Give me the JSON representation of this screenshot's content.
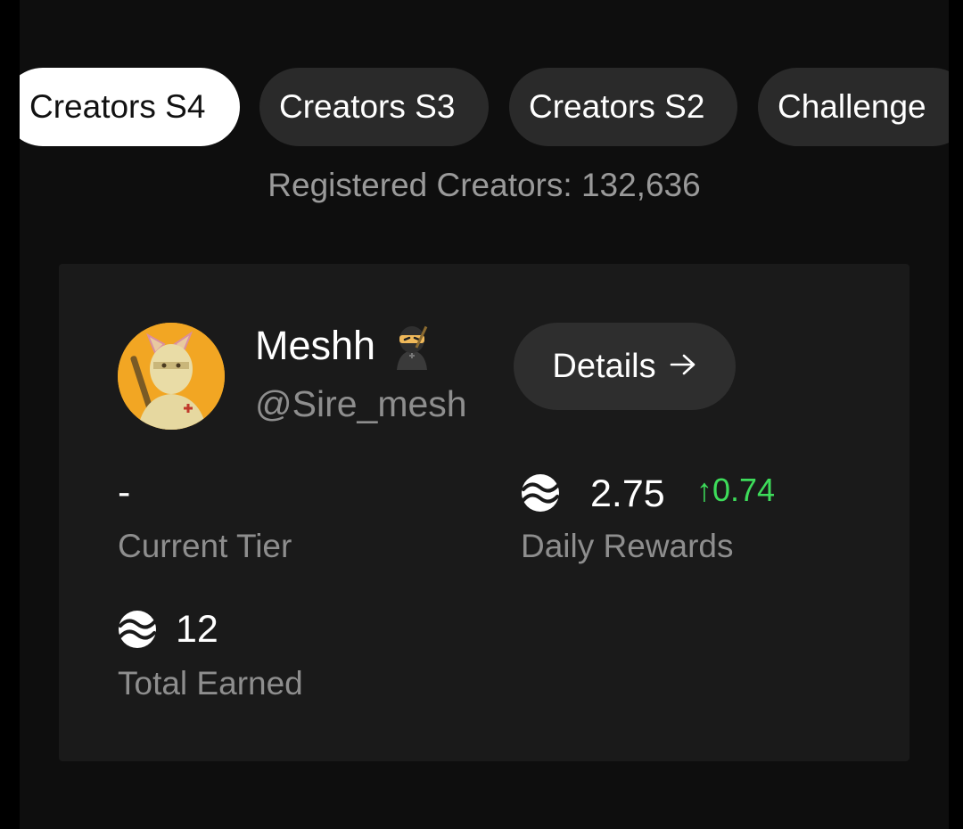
{
  "tabs": [
    {
      "label": "Creators S4",
      "active": true
    },
    {
      "label": "Creators S3",
      "active": false
    },
    {
      "label": "Creators S2",
      "active": false
    },
    {
      "label": "Challenge",
      "active": false
    }
  ],
  "registered_creators": "Registered Creators: 132,636",
  "profile": {
    "name": "Meshh",
    "emoji": "ninja",
    "handle": "@Sire_mesh",
    "details_label": "Details",
    "details_icon": "arrow-right-icon"
  },
  "stats": {
    "current_tier": {
      "value": "-",
      "label": "Current Tier"
    },
    "daily_rewards": {
      "value": "2.75",
      "change": "↑0.74",
      "label": "Daily Rewards",
      "icon": "token-icon"
    },
    "total_earned": {
      "value": "12",
      "label": "Total Earned",
      "icon": "token-icon"
    }
  },
  "colors": {
    "background": "#0e0e0e",
    "card": "#1a1a1a",
    "active_tab": "#ffffff",
    "inactive_tab": "#2a2a2a",
    "positive_change": "#3ddc5a",
    "muted_text": "#8e8e8e"
  }
}
